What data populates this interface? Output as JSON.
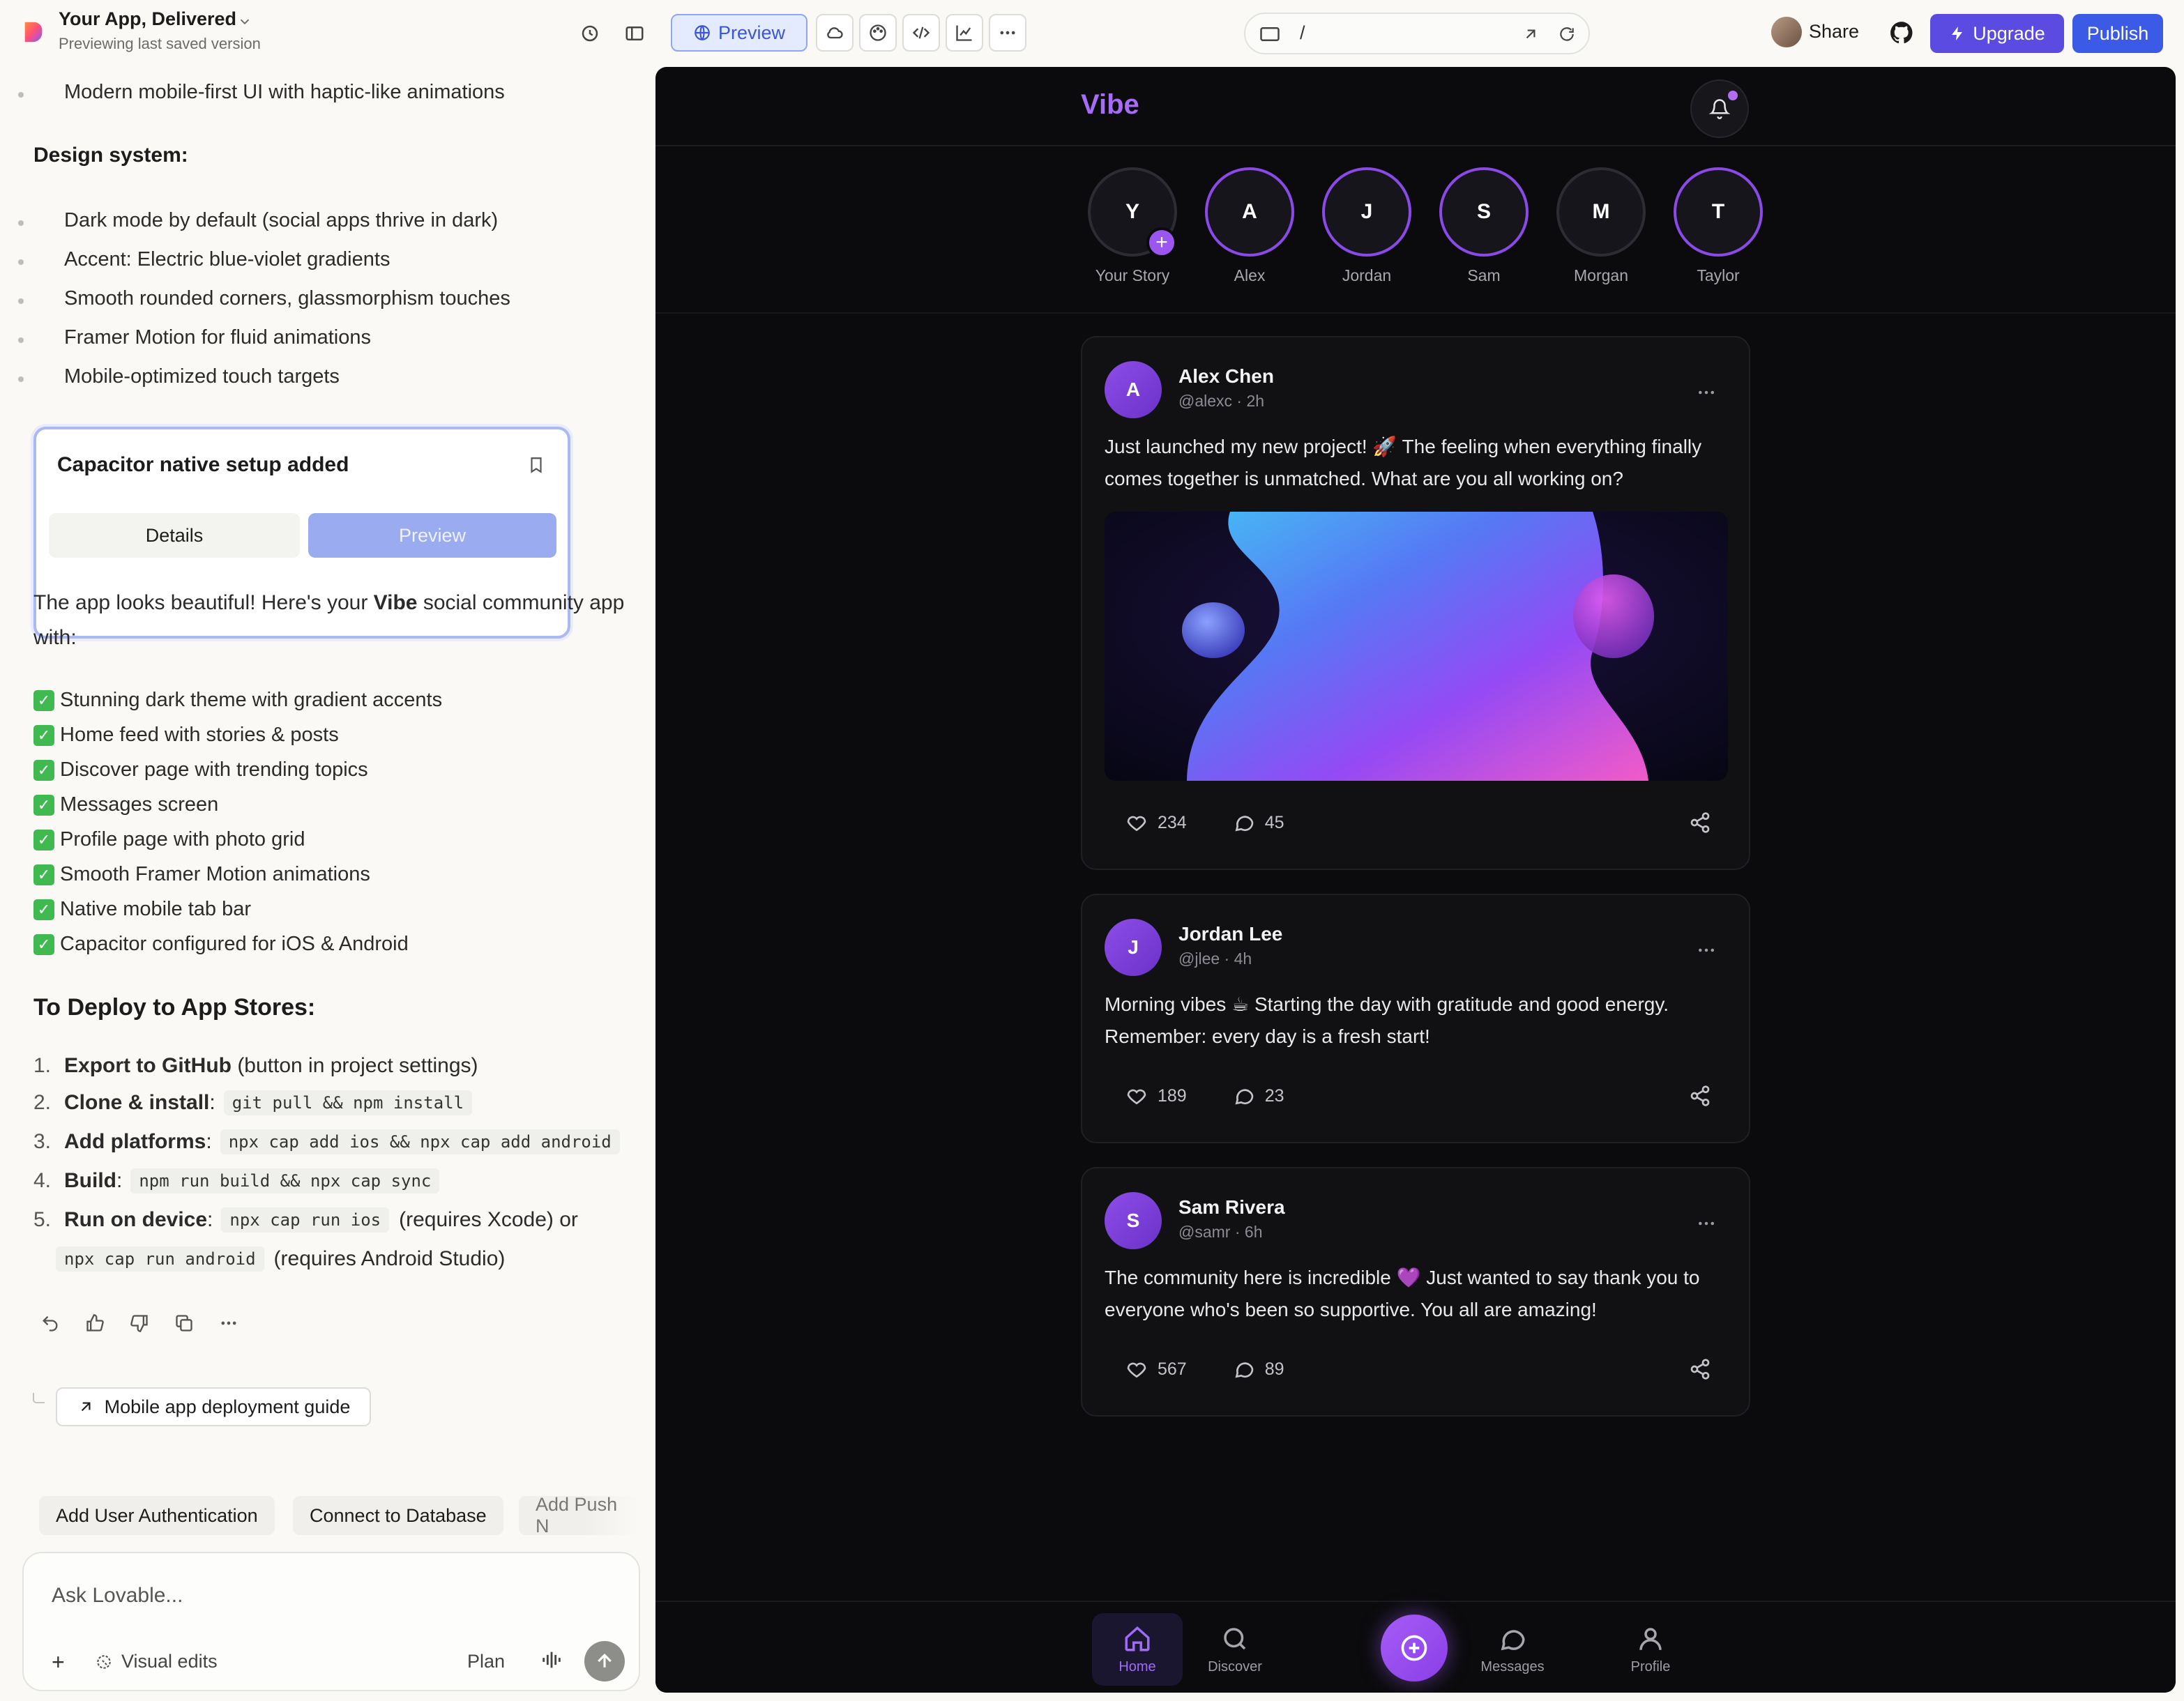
{
  "topbar": {
    "project_title": "Your App, Delivered",
    "project_subtitle": "Previewing last saved version",
    "preview_label": "Preview",
    "url_path": "/",
    "share_label": "Share",
    "upgrade_label": "Upgrade",
    "publish_label": "Publish"
  },
  "chat": {
    "top_bullet": "Modern mobile-first UI with haptic-like animations",
    "design_heading": "Design system:",
    "design_items": [
      "Dark mode by default (social apps thrive in dark)",
      "Accent: Electric blue-violet gradients",
      "Smooth rounded corners, glassmorphism touches",
      "Framer Motion for fluid animations",
      "Mobile-optimized touch targets"
    ],
    "card": {
      "title": "Capacitor native setup added",
      "details_label": "Details",
      "preview_label": "Preview"
    },
    "intro_pre": "The app looks beautiful! Here's your ",
    "intro_bold": "Vibe",
    "intro_post": " social community app with:",
    "checklist": [
      "Stunning dark theme with gradient accents",
      "Home feed with stories & posts",
      "Discover page with trending topics",
      "Messages screen",
      "Profile page with photo grid",
      "Smooth Framer Motion animations",
      "Native mobile tab bar",
      "Capacitor configured for iOS & Android"
    ],
    "deploy_heading": "To Deploy to App Stores:",
    "steps": [
      {
        "num": "1.",
        "bold": "Export to GitHub",
        "rest": " (button in project settings)"
      },
      {
        "num": "2.",
        "bold": "Clone & install",
        "code": "git pull && npm install"
      },
      {
        "num": "3.",
        "bold": "Add platforms",
        "code": "npx cap add ios && npx cap add android"
      },
      {
        "num": "4.",
        "bold": "Build",
        "code": "npm run build && npx cap sync"
      },
      {
        "num": "5.",
        "bold": "Run on device",
        "code": "npx cap run ios",
        "rest": "(requires Xcode) or"
      }
    ],
    "step5_cont_code": "npx cap run android",
    "step5_cont_rest": "(requires Android Studio)",
    "colon": ":",
    "guide_label": "Mobile app deployment guide",
    "suggestions": [
      "Add User Authentication",
      "Connect to Database",
      "Add Push N"
    ],
    "input_placeholder": "Ask Lovable...",
    "visual_edits_label": "Visual edits",
    "plan_label": "Plan"
  },
  "app": {
    "logo": "Vibe",
    "stories": [
      {
        "initial": "Y",
        "name": "Your Story",
        "own": true
      },
      {
        "initial": "A",
        "name": "Alex",
        "seen": false
      },
      {
        "initial": "J",
        "name": "Jordan",
        "seen": false
      },
      {
        "initial": "S",
        "name": "Sam",
        "seen": false
      },
      {
        "initial": "M",
        "name": "Morgan",
        "seen": true
      },
      {
        "initial": "T",
        "name": "Taylor",
        "seen": false
      }
    ],
    "posts": [
      {
        "initial": "A",
        "name": "Alex Chen",
        "meta": "@alexc · 2h",
        "text": "Just launched my new project! 🚀 The feeling when everything finally comes together is unmatched. What are you all working on?",
        "likes": "234",
        "comments": "45"
      },
      {
        "initial": "J",
        "name": "Jordan Lee",
        "meta": "@jlee · 4h",
        "text": "Morning vibes ☕ Starting the day with gratitude and good energy. Remember: every day is a fresh start!",
        "likes": "189",
        "comments": "23"
      },
      {
        "initial": "S",
        "name": "Sam Rivera",
        "meta": "@samr · 6h",
        "text": "The community here is incredible 💜 Just wanted to say thank you to everyone who's been so supportive. You all are amazing!",
        "likes": "567",
        "comments": "89"
      }
    ],
    "tabs": [
      "Home",
      "Discover",
      "Messages",
      "Profile"
    ],
    "accent": "#a66cf5"
  }
}
